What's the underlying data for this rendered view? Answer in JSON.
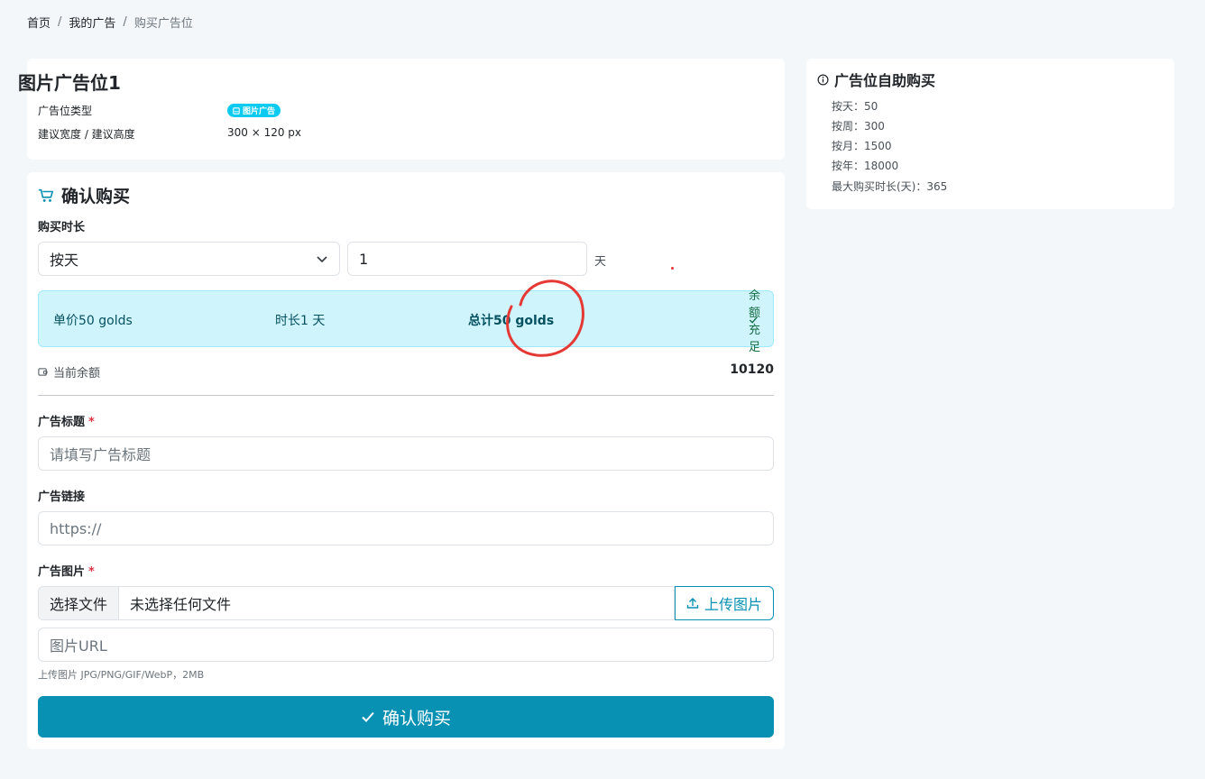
{
  "breadcrumb": {
    "home": "首页",
    "my_ads": "我的广告",
    "current": "购买广告位",
    "separator": "/"
  },
  "slot": {
    "title": "图片广告位1",
    "type_label": "广告位类型",
    "type_badge": "图片广告",
    "size_label": "建议宽度 / 建议高度",
    "size_value": "300 × 120 px"
  },
  "purchase": {
    "section_title": "确认购买",
    "duration_label": "购买时长",
    "duration_unit_selected": "按天",
    "duration_value": "1",
    "duration_unit_text": "天",
    "summary": {
      "unit_price": "单价50 golds",
      "duration": "时长1 天",
      "total": "总计50 golds",
      "sufficient": "余额充足"
    },
    "balance_label": "当前余额",
    "balance_value": "10120"
  },
  "form": {
    "title_label": "广告标题",
    "title_placeholder": "请填写广告标题",
    "link_label": "广告链接",
    "link_placeholder": "https://",
    "image_label": "广告图片",
    "file_button": "选择文件",
    "file_status": "未选择任何文件",
    "upload_button": "上传图片",
    "image_url_placeholder": "图片URL",
    "upload_hint": "上传图片 JPG/PNG/GIF/WebP，2MB",
    "required_mark": "*",
    "submit_button": "确认购买"
  },
  "sidebar": {
    "title": "广告位自助购买",
    "items": [
      "按天：50",
      "按周：300",
      "按月：1500",
      "按年：18000",
      "最大购买时长(天)：365"
    ]
  },
  "colors": {
    "accent": "#0891b2",
    "info_bg": "#cff4fc",
    "required": "#dc3545",
    "annotation": "#e53935"
  }
}
